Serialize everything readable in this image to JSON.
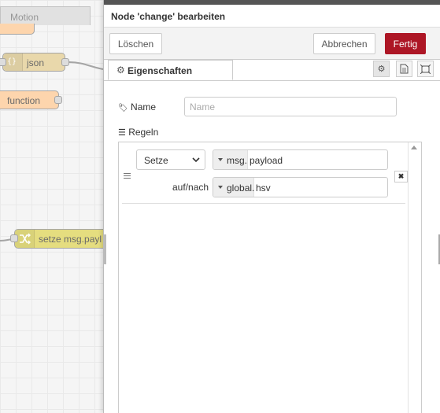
{
  "canvas": {
    "tab_label": "Motion",
    "nodes": {
      "json_label": "json",
      "json_icon": "{}",
      "function_label": "function",
      "change_label": "setze msg.payl",
      "change_icon": "shuffle-icon"
    },
    "colors": {
      "json": "#e6d3a0",
      "function": "#fdd0a2",
      "change": "#e2d96e"
    }
  },
  "tray": {
    "title": "Node 'change' bearbeiten",
    "buttons": {
      "delete": "Löschen",
      "cancel": "Abbrechen",
      "done": "Fertig"
    },
    "tabs": {
      "properties": "Eigenschaften"
    },
    "icons": {
      "settings": "gear-icon",
      "description": "file-icon",
      "appearance": "frame-icon"
    },
    "colors": {
      "done_button": "#ad1625"
    }
  },
  "form": {
    "name_label": "Name",
    "name_placeholder": "Name",
    "name_value": "",
    "rules_label": "Regeln",
    "rule": {
      "action": "Setze",
      "property_type": "msg.",
      "property_value": "payload",
      "to_label": "auf/nach",
      "target_type": "global.",
      "target_value": "hsv"
    }
  }
}
